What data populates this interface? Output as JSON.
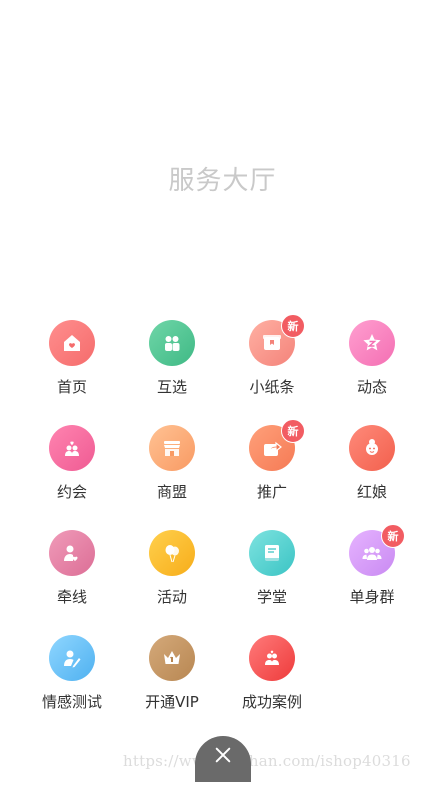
{
  "page": {
    "title": "服务大厅"
  },
  "badge_text": "新",
  "items": [
    {
      "label": "首页",
      "icon": "home-icon",
      "color_a": "#ff8e8e",
      "color_b": "#f56c6c",
      "badge": false
    },
    {
      "label": "互选",
      "icon": "couple-icon",
      "color_a": "#6fd6a8",
      "color_b": "#3fb985",
      "badge": false
    },
    {
      "label": "小纸条",
      "icon": "note-icon",
      "color_a": "#ffb0a3",
      "color_b": "#f4837a",
      "badge": true
    },
    {
      "label": "动态",
      "icon": "star-icon",
      "color_a": "#ff9fd0",
      "color_b": "#f46fb3",
      "badge": false
    },
    {
      "label": "约会",
      "icon": "date-icon",
      "color_a": "#ff84b0",
      "color_b": "#ef5b93",
      "badge": false
    },
    {
      "label": "商盟",
      "icon": "shop-icon",
      "color_a": "#ffc293",
      "color_b": "#f99a63",
      "badge": false
    },
    {
      "label": "推广",
      "icon": "share-icon",
      "color_a": "#ffa07a",
      "color_b": "#f57a55",
      "badge": true
    },
    {
      "label": "红娘",
      "icon": "matchmaker-icon",
      "color_a": "#ff8a7a",
      "color_b": "#f2604d",
      "badge": false
    },
    {
      "label": "牵线",
      "icon": "link-icon",
      "color_a": "#f09bb9",
      "color_b": "#dc6e96",
      "badge": false
    },
    {
      "label": "活动",
      "icon": "balloon-icon",
      "color_a": "#ffd04d",
      "color_b": "#f7ad1a",
      "badge": false
    },
    {
      "label": "学堂",
      "icon": "book-icon",
      "color_a": "#7ee3e0",
      "color_b": "#3bc4c4",
      "badge": false
    },
    {
      "label": "单身群",
      "icon": "group-icon",
      "color_a": "#e6b3ff",
      "color_b": "#c98af2",
      "badge": true
    },
    {
      "label": "情感测试",
      "icon": "test-icon",
      "color_a": "#8fd6ff",
      "color_b": "#4fb1f0",
      "badge": false
    },
    {
      "label": "开通VIP",
      "icon": "crown-icon",
      "color_a": "#d4a97a",
      "color_b": "#b88752",
      "badge": false
    },
    {
      "label": "成功案例",
      "icon": "success-icon",
      "color_a": "#ff7a7a",
      "color_b": "#ee3b3b",
      "badge": false
    }
  ],
  "watermark": "https://www.huzhan.com/ishop40316",
  "close": {
    "icon": "close-icon"
  }
}
